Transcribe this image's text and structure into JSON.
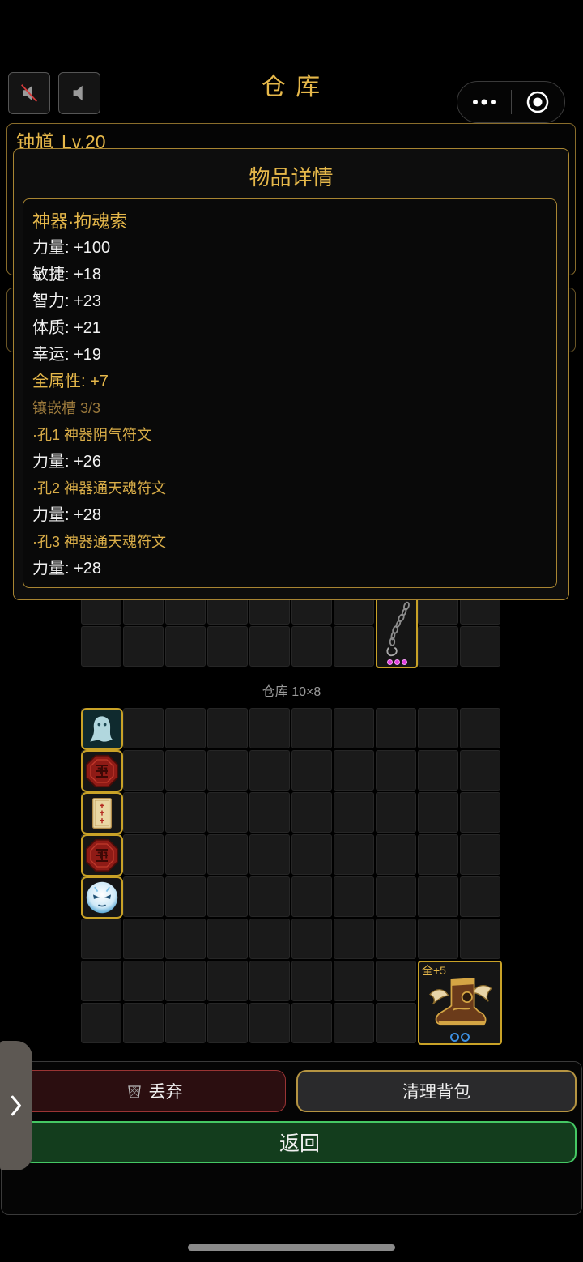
{
  "app": {
    "title": "仓 库"
  },
  "top_controls": {
    "mute_icon": "speaker-muted-icon",
    "sound_icon": "speaker-icon"
  },
  "capsule": {
    "more_icon": "more-icon",
    "close_icon": "target-icon"
  },
  "character": {
    "name": "钟馗",
    "level": "Lv.20"
  },
  "item_detail": {
    "title": "物品详情",
    "name": "神器·拘魂索",
    "stats": [
      "力量: +100",
      "敏捷: +18",
      "智力: +23",
      "体质: +21",
      "幸运: +19"
    ],
    "all_attributes": "全属性: +7",
    "socket_header": "镶嵌槽 3/3",
    "sockets": [
      {
        "rune": "·孔1 神器阴气符文",
        "bonus": "力量: +26"
      },
      {
        "rune": "·孔2 神器通天魂符文",
        "bonus": "力量: +28"
      },
      {
        "rune": "·孔3 神器通天魂符文",
        "bonus": "力量: +28"
      }
    ]
  },
  "backpack": {
    "items": [
      {
        "icon": "chain-icon",
        "sockets": 3,
        "filled_sockets": 3
      }
    ]
  },
  "warehouse": {
    "label": "仓库 10×8",
    "items": [
      {
        "icon": "ghost-icon"
      },
      {
        "icon": "red-seal-icon"
      },
      {
        "icon": "talisman-scroll-icon"
      },
      {
        "icon": "red-seal-icon"
      },
      {
        "icon": "ice-mask-icon"
      },
      {
        "icon": "winged-boots-icon",
        "badge": "全+5",
        "sockets": 2,
        "filled_sockets": 0
      }
    ]
  },
  "actions": {
    "discard_icon": "trash-icon",
    "discard_label": "丢弃",
    "clear_label": "清理背包",
    "back_label": "返回"
  },
  "side_tab": {
    "icon": "chevron-right-icon"
  },
  "theme": {
    "gold": "#e6b84a",
    "border_gold": "#a88532",
    "socket_filled": "#e23ee0",
    "socket_empty": "#3d8fe0",
    "danger": "#9a3434",
    "success": "#45c864"
  }
}
